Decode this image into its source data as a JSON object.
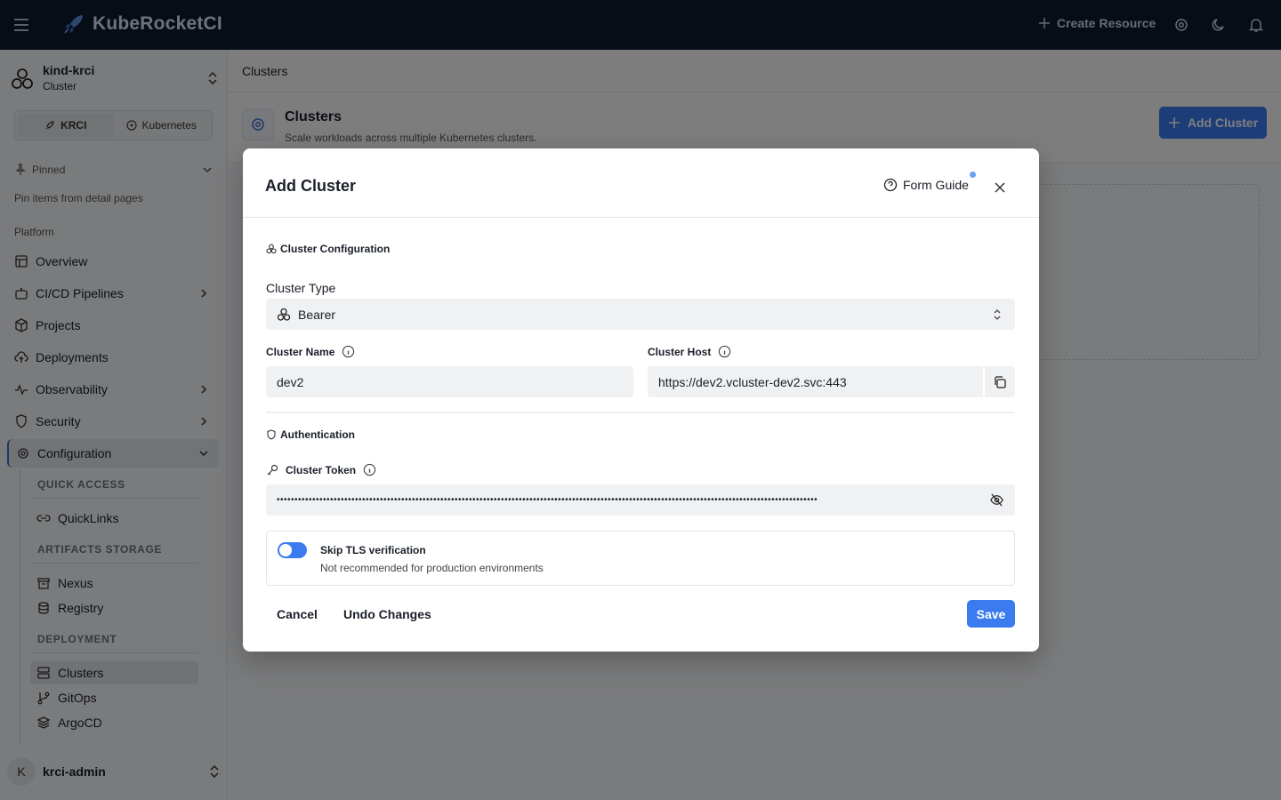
{
  "topbar": {
    "brand": "KubeRocketCI",
    "create_resource": "Create Resource"
  },
  "sidebar": {
    "cluster_name": "kind-krci",
    "cluster_sub": "Cluster",
    "seg_krci": "KRCI",
    "seg_kubernetes": "Kubernetes",
    "pinned": "Pinned",
    "pinned_note": "Pin items from detail pages",
    "platform": "Platform",
    "items": [
      {
        "label": "Overview"
      },
      {
        "label": "CI/CD Pipelines"
      },
      {
        "label": "Projects"
      },
      {
        "label": "Deployments"
      },
      {
        "label": "Observability"
      },
      {
        "label": "Security"
      },
      {
        "label": "Configuration"
      }
    ],
    "quick_access": "QUICK ACCESS",
    "quicklinks": "QuickLinks",
    "artifacts_storage": "ARTIFACTS STORAGE",
    "nexus": "Nexus",
    "registry": "Registry",
    "deployment": "DEPLOYMENT",
    "clusters": "Clusters",
    "gitops": "GitOps",
    "argocd": "ArgoCD",
    "user_initial": "K",
    "user_name": "krci-admin"
  },
  "page": {
    "breadcrumb": "Clusters",
    "title": "Clusters",
    "subtitle": "Scale workloads across multiple Kubernetes clusters.",
    "add_button": "Add Cluster"
  },
  "dialog": {
    "title": "Add Cluster",
    "form_guide": "Form Guide",
    "section_config": "Cluster Configuration",
    "cluster_type_label": "Cluster Type",
    "cluster_type_value": "Bearer",
    "cluster_name_label": "Cluster Name",
    "cluster_name_value": "dev2",
    "cluster_host_label": "Cluster Host",
    "cluster_host_value": "https://dev2.vcluster-dev2.svc:443",
    "section_auth": "Authentication",
    "token_label": "Cluster Token",
    "token_value": "••••••••••••••••••••••••••••••••••••••••••••••••••••••••••••••••••••••••••••••••••••••••••••••••••••••••••••••••••••••••••••••••••••••••••••••••••••••••",
    "tls_title": "Skip TLS verification",
    "tls_sub": "Not recommended for production environments",
    "tls_enabled": false,
    "cancel": "Cancel",
    "undo": "Undo Changes",
    "save": "Save"
  }
}
